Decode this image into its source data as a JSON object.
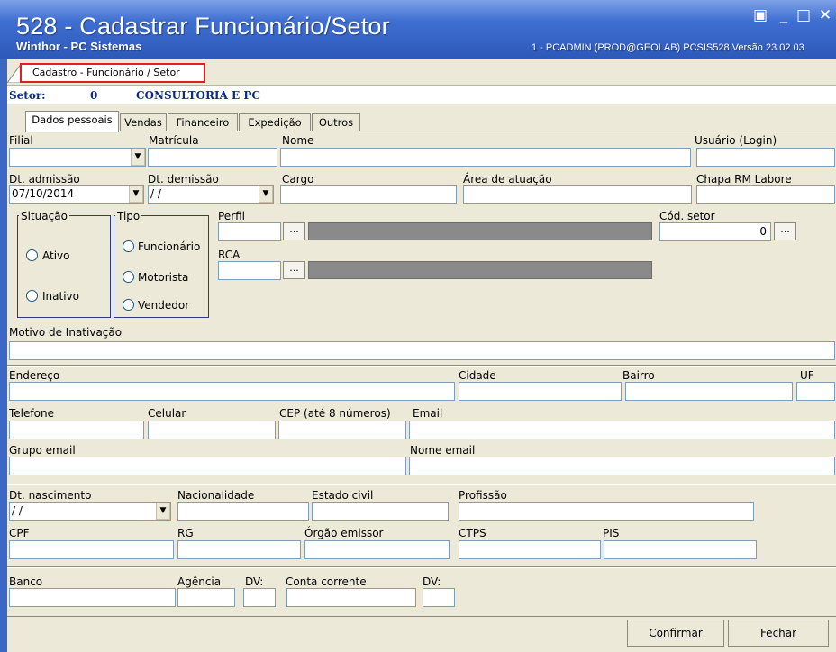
{
  "window": {
    "title": "528 - Cadastrar Funcionário/Setor",
    "subtitle": "Winthor - PC Sistemas",
    "system_info": "1 - PCADMIN (PROD@GEOLAB)   PCSIS528   Versão 23.02.03",
    "minimize_glyph": "_",
    "maximize_glyph": "□",
    "close_glyph": "✕",
    "restore_glyph": "▣"
  },
  "document_tab": "Cadastro - Funcionário / Setor",
  "setor": {
    "label": "Setor:",
    "code": "0",
    "name": "CONSULTORIA E PC"
  },
  "tabs": [
    {
      "label": "Dados pessoais"
    },
    {
      "label": "Vendas"
    },
    {
      "label": "Financeiro"
    },
    {
      "label": "Expedição"
    },
    {
      "label": "Outros"
    }
  ],
  "form": {
    "filial": {
      "label": "Filial",
      "value": ""
    },
    "matricula": {
      "label": "Matrícula",
      "value": ""
    },
    "nome": {
      "label": "Nome",
      "value": ""
    },
    "usuario": {
      "label": "Usuário (Login)",
      "value": ""
    },
    "dt_admissao": {
      "label": "Dt. admissão",
      "value": "07/10/2014"
    },
    "dt_demissao": {
      "label": "Dt. demissão",
      "value": " / /"
    },
    "cargo": {
      "label": "Cargo",
      "value": ""
    },
    "area_atuacao": {
      "label": "Área de atuação",
      "value": ""
    },
    "chapa_rm": {
      "label": "Chapa RM Labore",
      "value": ""
    },
    "situacao": {
      "label": "Situação",
      "options": [
        "Ativo",
        "Inativo"
      ]
    },
    "tipo": {
      "label": "Tipo",
      "options": [
        "Funcionário",
        "Motorista",
        "Vendedor"
      ]
    },
    "perfil": {
      "label": "Perfil",
      "value": "",
      "button": "..."
    },
    "rca": {
      "label": "RCA",
      "value": "",
      "button": "..."
    },
    "cod_setor": {
      "label": "Cód. setor",
      "value": "0",
      "button": "..."
    },
    "motivo_inativacao": {
      "label": "Motivo de Inativação",
      "value": ""
    },
    "endereco": {
      "label": "Endereço",
      "value": ""
    },
    "cidade": {
      "label": "Cidade",
      "value": ""
    },
    "bairro": {
      "label": "Bairro",
      "value": ""
    },
    "uf": {
      "label": "UF",
      "value": ""
    },
    "telefone": {
      "label": "Telefone",
      "value": ""
    },
    "celular": {
      "label": "Celular",
      "value": ""
    },
    "cep": {
      "label": "CEP (até 8 números)",
      "value": ""
    },
    "email": {
      "label": "Email",
      "value": ""
    },
    "grupo_email": {
      "label": "Grupo email",
      "value": ""
    },
    "nome_email": {
      "label": "Nome email",
      "value": ""
    },
    "dt_nascimento": {
      "label": "Dt. nascimento",
      "value": " / /"
    },
    "nacionalidade": {
      "label": "Nacionalidade",
      "value": ""
    },
    "estado_civil": {
      "label": "Estado civil",
      "value": ""
    },
    "profissao": {
      "label": "Profissão",
      "value": ""
    },
    "cpf": {
      "label": "CPF",
      "value": ""
    },
    "rg": {
      "label": "RG",
      "value": ""
    },
    "orgao_emissor": {
      "label": "Órgão emissor",
      "value": ""
    },
    "ctps": {
      "label": "CTPS",
      "value": ""
    },
    "pis": {
      "label": "PIS",
      "value": ""
    },
    "banco": {
      "label": "Banco",
      "value": ""
    },
    "agencia": {
      "label": "Agência",
      "value": ""
    },
    "dv1": {
      "label": "DV:",
      "value": ""
    },
    "conta_corrente": {
      "label": "Conta corrente",
      "value": ""
    },
    "dv2": {
      "label": "DV:",
      "value": ""
    },
    "dropdown_glyph": "▼"
  },
  "buttons": {
    "confirmar": "Confirmar",
    "fechar": "Fechar"
  }
}
